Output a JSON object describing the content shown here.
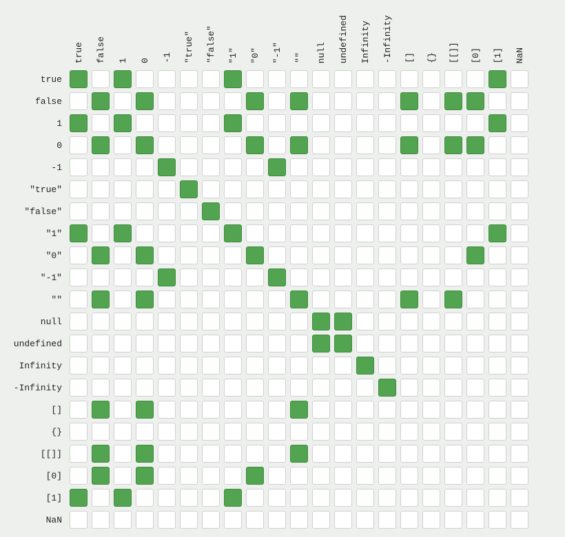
{
  "chart_data": {
    "type": "heatmap",
    "title": "",
    "labels": [
      "true",
      "false",
      "1",
      "0",
      "-1",
      "\"true\"",
      "\"false\"",
      "\"1\"",
      "\"0\"",
      "\"-1\"",
      "\"\"",
      "null",
      "undefined",
      "Infinity",
      "-Infinity",
      "[]",
      "{}",
      "[[]]",
      "[0]",
      "[1]",
      "NaN"
    ],
    "matrix": [
      [
        1,
        0,
        1,
        0,
        0,
        0,
        0,
        1,
        0,
        0,
        0,
        0,
        0,
        0,
        0,
        0,
        0,
        0,
        0,
        1,
        0
      ],
      [
        0,
        1,
        0,
        1,
        0,
        0,
        0,
        0,
        1,
        0,
        1,
        0,
        0,
        0,
        0,
        1,
        0,
        1,
        1,
        0,
        0
      ],
      [
        1,
        0,
        1,
        0,
        0,
        0,
        0,
        1,
        0,
        0,
        0,
        0,
        0,
        0,
        0,
        0,
        0,
        0,
        0,
        1,
        0
      ],
      [
        0,
        1,
        0,
        1,
        0,
        0,
        0,
        0,
        1,
        0,
        1,
        0,
        0,
        0,
        0,
        1,
        0,
        1,
        1,
        0,
        0
      ],
      [
        0,
        0,
        0,
        0,
        1,
        0,
        0,
        0,
        0,
        1,
        0,
        0,
        0,
        0,
        0,
        0,
        0,
        0,
        0,
        0,
        0
      ],
      [
        0,
        0,
        0,
        0,
        0,
        1,
        0,
        0,
        0,
        0,
        0,
        0,
        0,
        0,
        0,
        0,
        0,
        0,
        0,
        0,
        0
      ],
      [
        0,
        0,
        0,
        0,
        0,
        0,
        1,
        0,
        0,
        0,
        0,
        0,
        0,
        0,
        0,
        0,
        0,
        0,
        0,
        0,
        0
      ],
      [
        1,
        0,
        1,
        0,
        0,
        0,
        0,
        1,
        0,
        0,
        0,
        0,
        0,
        0,
        0,
        0,
        0,
        0,
        0,
        1,
        0
      ],
      [
        0,
        1,
        0,
        1,
        0,
        0,
        0,
        0,
        1,
        0,
        0,
        0,
        0,
        0,
        0,
        0,
        0,
        0,
        1,
        0,
        0
      ],
      [
        0,
        0,
        0,
        0,
        1,
        0,
        0,
        0,
        0,
        1,
        0,
        0,
        0,
        0,
        0,
        0,
        0,
        0,
        0,
        0,
        0
      ],
      [
        0,
        1,
        0,
        1,
        0,
        0,
        0,
        0,
        0,
        0,
        1,
        0,
        0,
        0,
        0,
        1,
        0,
        1,
        0,
        0,
        0
      ],
      [
        0,
        0,
        0,
        0,
        0,
        0,
        0,
        0,
        0,
        0,
        0,
        1,
        1,
        0,
        0,
        0,
        0,
        0,
        0,
        0,
        0
      ],
      [
        0,
        0,
        0,
        0,
        0,
        0,
        0,
        0,
        0,
        0,
        0,
        1,
        1,
        0,
        0,
        0,
        0,
        0,
        0,
        0,
        0
      ],
      [
        0,
        0,
        0,
        0,
        0,
        0,
        0,
        0,
        0,
        0,
        0,
        0,
        0,
        1,
        0,
        0,
        0,
        0,
        0,
        0,
        0
      ],
      [
        0,
        0,
        0,
        0,
        0,
        0,
        0,
        0,
        0,
        0,
        0,
        0,
        0,
        0,
        1,
        0,
        0,
        0,
        0,
        0,
        0
      ],
      [
        0,
        1,
        0,
        1,
        0,
        0,
        0,
        0,
        0,
        0,
        1,
        0,
        0,
        0,
        0,
        0,
        0,
        0,
        0,
        0,
        0
      ],
      [
        0,
        0,
        0,
        0,
        0,
        0,
        0,
        0,
        0,
        0,
        0,
        0,
        0,
        0,
        0,
        0,
        0,
        0,
        0,
        0,
        0
      ],
      [
        0,
        1,
        0,
        1,
        0,
        0,
        0,
        0,
        0,
        0,
        1,
        0,
        0,
        0,
        0,
        0,
        0,
        0,
        0,
        0,
        0
      ],
      [
        0,
        1,
        0,
        1,
        0,
        0,
        0,
        0,
        1,
        0,
        0,
        0,
        0,
        0,
        0,
        0,
        0,
        0,
        0,
        0,
        0
      ],
      [
        1,
        0,
        1,
        0,
        0,
        0,
        0,
        1,
        0,
        0,
        0,
        0,
        0,
        0,
        0,
        0,
        0,
        0,
        0,
        0,
        0
      ],
      [
        0,
        0,
        0,
        0,
        0,
        0,
        0,
        0,
        0,
        0,
        0,
        0,
        0,
        0,
        0,
        0,
        0,
        0,
        0,
        0,
        0
      ]
    ],
    "colors": {
      "true": "#53a451",
      "false": "#ffffff"
    }
  }
}
